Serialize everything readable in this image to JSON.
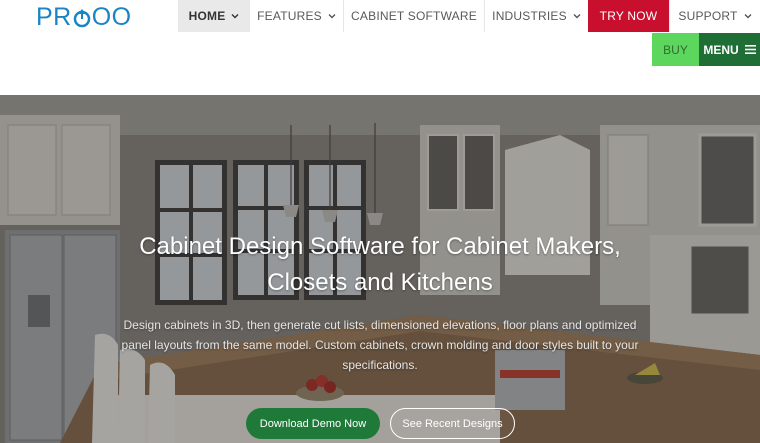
{
  "header": {
    "logo_text": "PROOO",
    "nav": [
      {
        "label": "HOME",
        "has_dropdown": true,
        "active": true
      },
      {
        "label": "FEATURES",
        "has_dropdown": true
      },
      {
        "label": "CABINET SOFTWARE",
        "has_dropdown": false
      },
      {
        "label": "INDUSTRIES",
        "has_dropdown": true
      },
      {
        "label": "TRY NOW",
        "has_dropdown": false
      },
      {
        "label": "SUPPORT",
        "has_dropdown": true
      }
    ],
    "buy_label": "BUY",
    "menu_label": "MENU"
  },
  "hero": {
    "title_line1": "Cabinet Design Software for Cabinet Makers,",
    "title_line2": "Closets and Kitchens",
    "subtitle": "Design cabinets in 3D, then generate cut lists, dimensioned elevations, floor plans and optimized panel layouts from the same model. Custom cabinets, crown molding and door styles built to your specifications.",
    "demo_button": "Download Demo Now",
    "designs_button": "See Recent Designs"
  },
  "colors": {
    "brand_blue": "#1a84c6",
    "try_now_red": "#c8102e",
    "buy_green": "#5cd65c",
    "menu_green": "#1e6e36",
    "demo_green": "#1f7a3a"
  },
  "icons": {
    "dropdown": "chevron-down-icon",
    "menu": "hamburger-icon"
  }
}
